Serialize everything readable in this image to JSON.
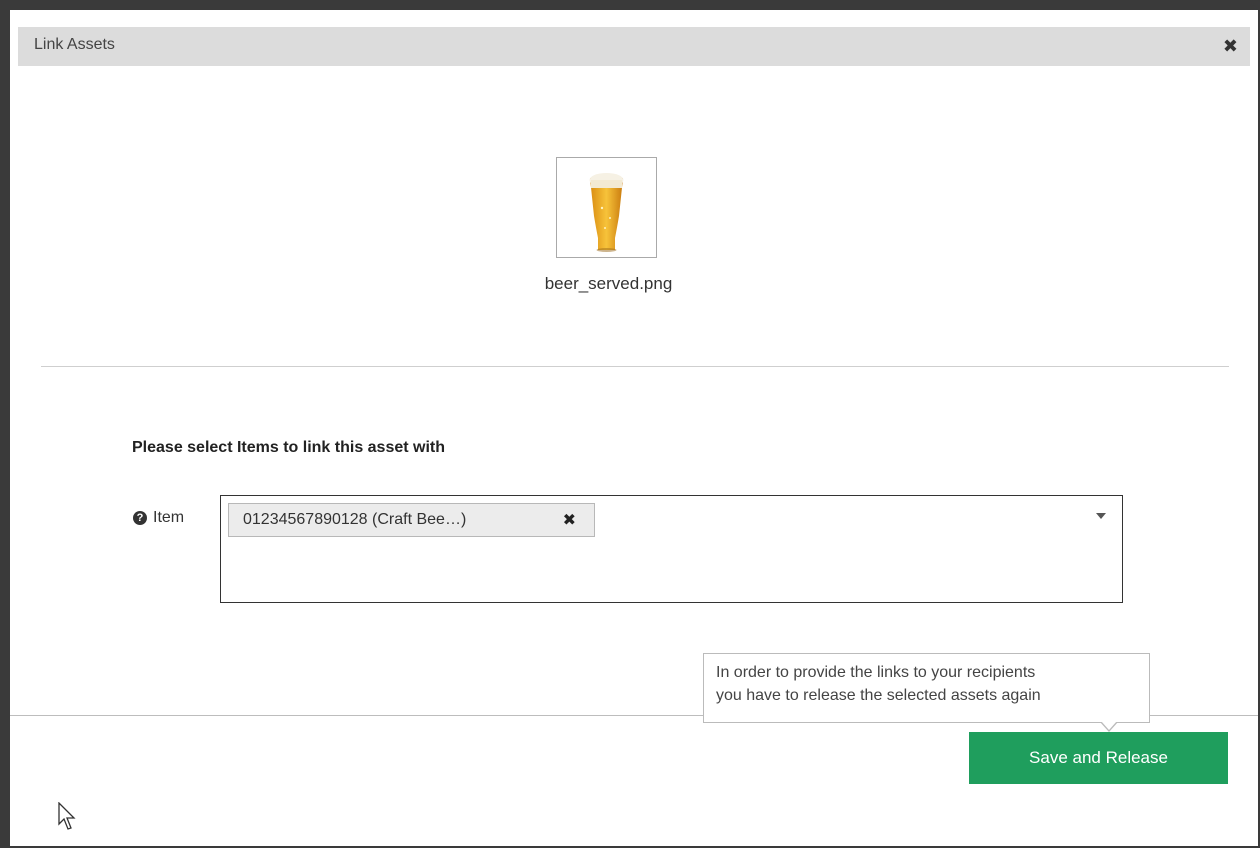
{
  "dialog": {
    "title": "Link Assets",
    "close_icon": "close-icon"
  },
  "asset": {
    "filename": "beer_served.png",
    "thumbnail_icon": "beer-glass-image"
  },
  "form": {
    "instruction": "Please select Items to link this asset with",
    "item_label": "Item",
    "help_icon": "question-circle-icon",
    "selected_items": [
      {
        "label": "01234567890128 (Craft Bee…)"
      }
    ]
  },
  "tooltip": {
    "line1": "In order to provide the links to your recipients",
    "line2": "you have to release the selected assets again"
  },
  "footer": {
    "save_label": "Save and Release"
  },
  "colors": {
    "header_bg": "#dcdcdc",
    "primary_button": "#1f9e5d",
    "frame": "#3a3a3a"
  }
}
